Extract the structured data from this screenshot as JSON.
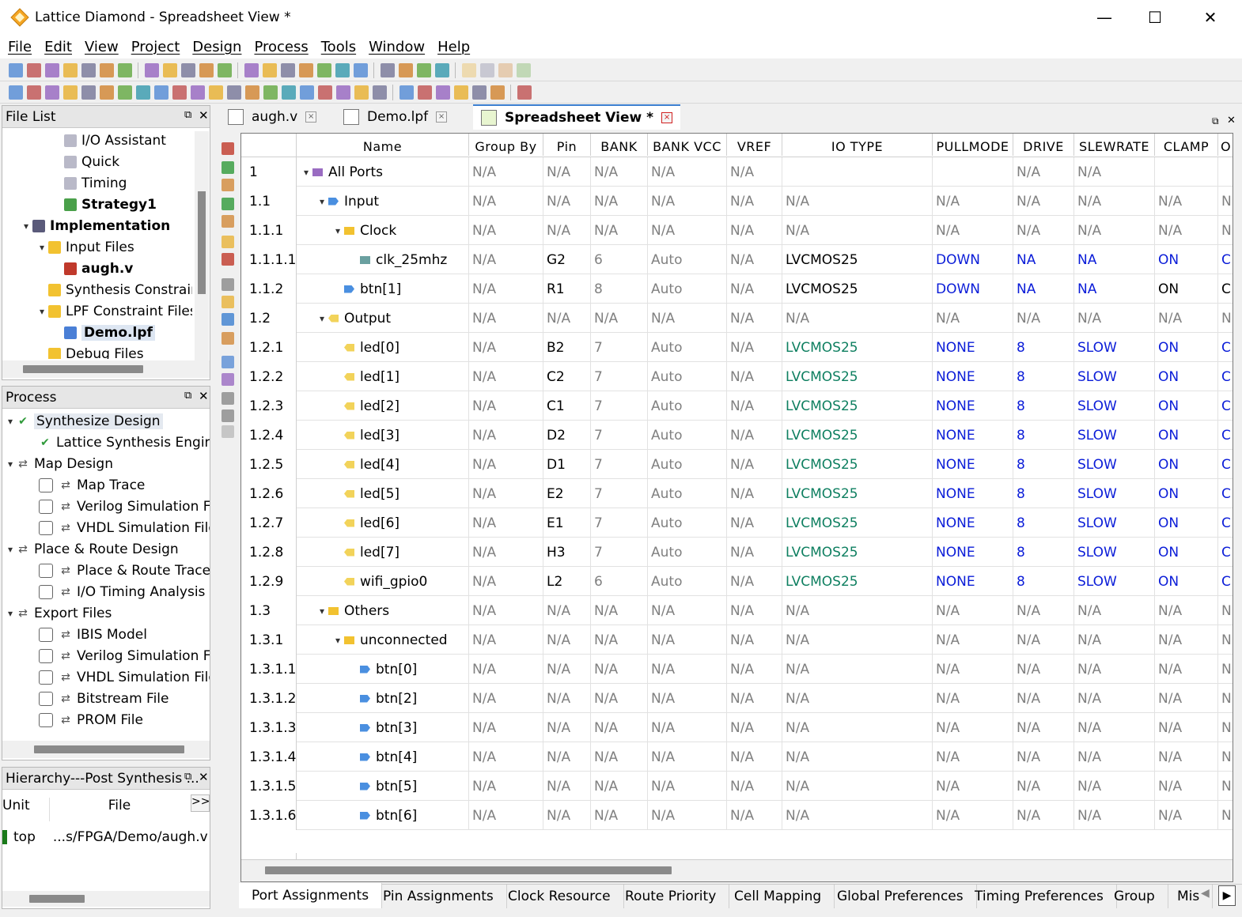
{
  "window": {
    "title": "Lattice Diamond - Spreadsheet View *",
    "minimize": "—",
    "maximize": "☐",
    "close": "✕"
  },
  "menu": [
    "File",
    "Edit",
    "View",
    "Project",
    "Design",
    "Process",
    "Tools",
    "Window",
    "Help"
  ],
  "file_list": {
    "title": "File List",
    "items": [
      {
        "label": "I/O Assistant",
        "indent": 3,
        "bold": false,
        "icon": "strategy-item-icon"
      },
      {
        "label": "Quick",
        "indent": 3,
        "bold": false,
        "icon": "strategy-item-icon"
      },
      {
        "label": "Timing",
        "indent": 3,
        "bold": false,
        "icon": "strategy-item-icon"
      },
      {
        "label": "Strategy1",
        "indent": 3,
        "bold": true,
        "icon": "strategy-active-icon"
      },
      {
        "label": "Implementation",
        "indent": 1,
        "bold": true,
        "icon": "implementation-icon",
        "arrow": "down"
      },
      {
        "label": "Input Files",
        "indent": 2,
        "bold": false,
        "icon": "folder-icon",
        "arrow": "down"
      },
      {
        "label": "augh.v",
        "indent": 3,
        "bold": true,
        "icon": "verilog-file-icon"
      },
      {
        "label": "Synthesis Constraint Files",
        "indent": 2,
        "bold": false,
        "icon": "folder-icon"
      },
      {
        "label": "LPF Constraint Files",
        "indent": 2,
        "bold": false,
        "icon": "folder-icon",
        "arrow": "down"
      },
      {
        "label": "Demo.lpf",
        "indent": 3,
        "bold": true,
        "icon": "lpf-file-icon",
        "selected": true
      },
      {
        "label": "Debug Files",
        "indent": 2,
        "bold": false,
        "icon": "folder-icon"
      }
    ]
  },
  "process": {
    "title": "Process",
    "items": [
      {
        "label": "Synthesize Design",
        "indent": 0,
        "arrow": "down",
        "icon": "check-run-icon",
        "highlight": true
      },
      {
        "label": "Lattice Synthesis Engine",
        "indent": 1,
        "icon": "check-run-icon"
      },
      {
        "label": "Map Design",
        "indent": 0,
        "arrow": "down",
        "icon": "run-icon"
      },
      {
        "label": "Map Trace",
        "indent": 1,
        "icon": "run-icon",
        "checkbox": true
      },
      {
        "label": "Verilog Simulation File",
        "indent": 1,
        "icon": "run-icon",
        "checkbox": true
      },
      {
        "label": "VHDL Simulation File",
        "indent": 1,
        "icon": "run-icon",
        "checkbox": true
      },
      {
        "label": "Place & Route Design",
        "indent": 0,
        "arrow": "down",
        "icon": "run-icon"
      },
      {
        "label": "Place & Route Trace",
        "indent": 1,
        "icon": "run-icon",
        "checkbox": true
      },
      {
        "label": "I/O Timing Analysis",
        "indent": 1,
        "icon": "run-icon",
        "checkbox": true
      },
      {
        "label": "Export Files",
        "indent": 0,
        "arrow": "down",
        "icon": "run-icon"
      },
      {
        "label": "IBIS Model",
        "indent": 1,
        "icon": "run-icon",
        "checkbox": true
      },
      {
        "label": "Verilog Simulation File",
        "indent": 1,
        "icon": "run-icon",
        "checkbox": true
      },
      {
        "label": "VHDL Simulation File",
        "indent": 1,
        "icon": "run-icon",
        "checkbox": true
      },
      {
        "label": "Bitstream File",
        "indent": 1,
        "icon": "run-icon",
        "checkbox": true
      },
      {
        "label": "PROM File",
        "indent": 1,
        "icon": "run-icon",
        "checkbox": true
      }
    ]
  },
  "hierarchy": {
    "title": "Hierarchy---Post Synthesis ...",
    "col_unit": "Unit",
    "col_file": "File",
    "expand": ">>",
    "row_unit": "top",
    "row_file": "...s/FPGA/Demo/augh.v"
  },
  "doc_tabs": [
    {
      "label": "augh.v",
      "icon": "verilog-doc-icon"
    },
    {
      "label": "Demo.lpf",
      "icon": "lpf-doc-icon"
    },
    {
      "label": "Spreadsheet View *",
      "icon": "spreadsheet-icon",
      "active": true
    }
  ],
  "columns": [
    "Name",
    "Group By",
    "Pin",
    "BANK",
    "BANK VCC",
    "VREF",
    "IO TYPE",
    "PULLMODE",
    "DRIVE",
    "SLEWRATE",
    "CLAMP",
    "O"
  ],
  "rows": [
    {
      "num": "1",
      "name": "All Ports",
      "depth": 0,
      "icon": "all-ports",
      "arrow": true,
      "group": "N/A",
      "pin": "N/A",
      "bank": "N/A",
      "vcc": "N/A",
      "vref": "N/A",
      "iotype": "",
      "pull": "",
      "drive": "N/A",
      "slew": "N/A",
      "clamp": "",
      "o": "",
      "style": "grey"
    },
    {
      "num": "1.1",
      "name": "Input",
      "depth": 1,
      "icon": "input",
      "arrow": true,
      "group": "N/A",
      "pin": "N/A",
      "bank": "N/A",
      "vcc": "N/A",
      "vref": "N/A",
      "iotype": "N/A",
      "pull": "N/A",
      "drive": "N/A",
      "slew": "N/A",
      "clamp": "N/A",
      "o": "N",
      "style": "grey"
    },
    {
      "num": "1.1.1",
      "name": "Clock",
      "depth": 2,
      "icon": "folder",
      "arrow": true,
      "group": "N/A",
      "pin": "N/A",
      "bank": "N/A",
      "vcc": "N/A",
      "vref": "N/A",
      "iotype": "N/A",
      "pull": "N/A",
      "drive": "N/A",
      "slew": "N/A",
      "clamp": "N/A",
      "o": "N",
      "style": "grey"
    },
    {
      "num": "1.1.1.1",
      "name": "clk_25mhz",
      "depth": 3,
      "icon": "clock",
      "arrow": false,
      "group": "N/A",
      "pin": "G2",
      "bank": "6",
      "vcc": "Auto",
      "vref": "N/A",
      "iotype": "LVCMOS25",
      "pull": "DOWN",
      "drive": "NA",
      "slew": "NA",
      "clamp": "ON",
      "o": "C",
      "style": "assigned-black"
    },
    {
      "num": "1.1.2",
      "name": "btn[1]",
      "depth": 2,
      "icon": "input",
      "arrow": false,
      "group": "N/A",
      "pin": "R1",
      "bank": "8",
      "vcc": "Auto",
      "vref": "N/A",
      "iotype": "LVCMOS25",
      "pull": "DOWN",
      "drive": "NA",
      "slew": "NA",
      "clamp": "ON",
      "o": "C",
      "style": "assigned-btn"
    },
    {
      "num": "1.2",
      "name": "Output",
      "depth": 1,
      "icon": "output",
      "arrow": true,
      "group": "N/A",
      "pin": "N/A",
      "bank": "N/A",
      "vcc": "N/A",
      "vref": "N/A",
      "iotype": "N/A",
      "pull": "N/A",
      "drive": "N/A",
      "slew": "N/A",
      "clamp": "N/A",
      "o": "N",
      "style": "grey"
    },
    {
      "num": "1.2.1",
      "name": "led[0]",
      "depth": 2,
      "icon": "output",
      "arrow": false,
      "group": "N/A",
      "pin": "B2",
      "bank": "7",
      "vcc": "Auto",
      "vref": "N/A",
      "iotype": "LVCMOS25",
      "pull": "NONE",
      "drive": "8",
      "slew": "SLOW",
      "clamp": "ON",
      "o": "C",
      "style": "assigned-led"
    },
    {
      "num": "1.2.2",
      "name": "led[1]",
      "depth": 2,
      "icon": "output",
      "arrow": false,
      "group": "N/A",
      "pin": "C2",
      "bank": "7",
      "vcc": "Auto",
      "vref": "N/A",
      "iotype": "LVCMOS25",
      "pull": "NONE",
      "drive": "8",
      "slew": "SLOW",
      "clamp": "ON",
      "o": "C",
      "style": "assigned-led"
    },
    {
      "num": "1.2.3",
      "name": "led[2]",
      "depth": 2,
      "icon": "output",
      "arrow": false,
      "group": "N/A",
      "pin": "C1",
      "bank": "7",
      "vcc": "Auto",
      "vref": "N/A",
      "iotype": "LVCMOS25",
      "pull": "NONE",
      "drive": "8",
      "slew": "SLOW",
      "clamp": "ON",
      "o": "C",
      "style": "assigned-led"
    },
    {
      "num": "1.2.4",
      "name": "led[3]",
      "depth": 2,
      "icon": "output",
      "arrow": false,
      "group": "N/A",
      "pin": "D2",
      "bank": "7",
      "vcc": "Auto",
      "vref": "N/A",
      "iotype": "LVCMOS25",
      "pull": "NONE",
      "drive": "8",
      "slew": "SLOW",
      "clamp": "ON",
      "o": "C",
      "style": "assigned-led"
    },
    {
      "num": "1.2.5",
      "name": "led[4]",
      "depth": 2,
      "icon": "output",
      "arrow": false,
      "group": "N/A",
      "pin": "D1",
      "bank": "7",
      "vcc": "Auto",
      "vref": "N/A",
      "iotype": "LVCMOS25",
      "pull": "NONE",
      "drive": "8",
      "slew": "SLOW",
      "clamp": "ON",
      "o": "C",
      "style": "assigned-led"
    },
    {
      "num": "1.2.6",
      "name": "led[5]",
      "depth": 2,
      "icon": "output",
      "arrow": false,
      "group": "N/A",
      "pin": "E2",
      "bank": "7",
      "vcc": "Auto",
      "vref": "N/A",
      "iotype": "LVCMOS25",
      "pull": "NONE",
      "drive": "8",
      "slew": "SLOW",
      "clamp": "ON",
      "o": "C",
      "style": "assigned-led"
    },
    {
      "num": "1.2.7",
      "name": "led[6]",
      "depth": 2,
      "icon": "output",
      "arrow": false,
      "group": "N/A",
      "pin": "E1",
      "bank": "7",
      "vcc": "Auto",
      "vref": "N/A",
      "iotype": "LVCMOS25",
      "pull": "NONE",
      "drive": "8",
      "slew": "SLOW",
      "clamp": "ON",
      "o": "C",
      "style": "assigned-led"
    },
    {
      "num": "1.2.8",
      "name": "led[7]",
      "depth": 2,
      "icon": "output",
      "arrow": false,
      "group": "N/A",
      "pin": "H3",
      "bank": "7",
      "vcc": "Auto",
      "vref": "N/A",
      "iotype": "LVCMOS25",
      "pull": "NONE",
      "drive": "8",
      "slew": "SLOW",
      "clamp": "ON",
      "o": "C",
      "style": "assigned-led"
    },
    {
      "num": "1.2.9",
      "name": "wifi_gpio0",
      "depth": 2,
      "icon": "output",
      "arrow": false,
      "group": "N/A",
      "pin": "L2",
      "bank": "6",
      "vcc": "Auto",
      "vref": "N/A",
      "iotype": "LVCMOS25",
      "pull": "NONE",
      "drive": "8",
      "slew": "SLOW",
      "clamp": "ON",
      "o": "C",
      "style": "assigned-led"
    },
    {
      "num": "1.3",
      "name": "Others",
      "depth": 1,
      "icon": "folder",
      "arrow": true,
      "group": "N/A",
      "pin": "N/A",
      "bank": "N/A",
      "vcc": "N/A",
      "vref": "N/A",
      "iotype": "N/A",
      "pull": "N/A",
      "drive": "N/A",
      "slew": "N/A",
      "clamp": "N/A",
      "o": "N",
      "style": "grey"
    },
    {
      "num": "1.3.1",
      "name": "unconnected",
      "depth": 2,
      "icon": "folder",
      "arrow": true,
      "group": "N/A",
      "pin": "N/A",
      "bank": "N/A",
      "vcc": "N/A",
      "vref": "N/A",
      "iotype": "N/A",
      "pull": "N/A",
      "drive": "N/A",
      "slew": "N/A",
      "clamp": "N/A",
      "o": "N",
      "style": "grey"
    },
    {
      "num": "1.3.1.1",
      "name": "btn[0]",
      "depth": 3,
      "icon": "input",
      "arrow": false,
      "group": "N/A",
      "pin": "N/A",
      "bank": "N/A",
      "vcc": "N/A",
      "vref": "N/A",
      "iotype": "N/A",
      "pull": "N/A",
      "drive": "N/A",
      "slew": "N/A",
      "clamp": "N/A",
      "o": "N",
      "style": "grey"
    },
    {
      "num": "1.3.1.2",
      "name": "btn[2]",
      "depth": 3,
      "icon": "input",
      "arrow": false,
      "group": "N/A",
      "pin": "N/A",
      "bank": "N/A",
      "vcc": "N/A",
      "vref": "N/A",
      "iotype": "N/A",
      "pull": "N/A",
      "drive": "N/A",
      "slew": "N/A",
      "clamp": "N/A",
      "o": "N",
      "style": "grey"
    },
    {
      "num": "1.3.1.3",
      "name": "btn[3]",
      "depth": 3,
      "icon": "input",
      "arrow": false,
      "group": "N/A",
      "pin": "N/A",
      "bank": "N/A",
      "vcc": "N/A",
      "vref": "N/A",
      "iotype": "N/A",
      "pull": "N/A",
      "drive": "N/A",
      "slew": "N/A",
      "clamp": "N/A",
      "o": "N",
      "style": "grey"
    },
    {
      "num": "1.3.1.4",
      "name": "btn[4]",
      "depth": 3,
      "icon": "input",
      "arrow": false,
      "group": "N/A",
      "pin": "N/A",
      "bank": "N/A",
      "vcc": "N/A",
      "vref": "N/A",
      "iotype": "N/A",
      "pull": "N/A",
      "drive": "N/A",
      "slew": "N/A",
      "clamp": "N/A",
      "o": "N",
      "style": "grey"
    },
    {
      "num": "1.3.1.5",
      "name": "btn[5]",
      "depth": 3,
      "icon": "input",
      "arrow": false,
      "group": "N/A",
      "pin": "N/A",
      "bank": "N/A",
      "vcc": "N/A",
      "vref": "N/A",
      "iotype": "N/A",
      "pull": "N/A",
      "drive": "N/A",
      "slew": "N/A",
      "clamp": "N/A",
      "o": "N",
      "style": "grey"
    },
    {
      "num": "1.3.1.6",
      "name": "btn[6]",
      "depth": 3,
      "icon": "input",
      "arrow": false,
      "group": "N/A",
      "pin": "N/A",
      "bank": "N/A",
      "vcc": "N/A",
      "vref": "N/A",
      "iotype": "N/A",
      "pull": "N/A",
      "drive": "N/A",
      "slew": "N/A",
      "clamp": "N/A",
      "o": "N",
      "style": "grey"
    }
  ],
  "bottom_tabs": [
    "Port Assignments",
    "Pin Assignments",
    "Clock Resource",
    "Route Priority",
    "Cell Mapping",
    "Global Preferences",
    "Timing Preferences",
    "Group",
    "Mis"
  ],
  "colors": {
    "accent_blue": "#0a1cd8",
    "iotype_green": "#0e7f60",
    "na_grey": "#808080",
    "folder_yellow": "#f2c230",
    "port_blue": "#4a8fe0"
  }
}
